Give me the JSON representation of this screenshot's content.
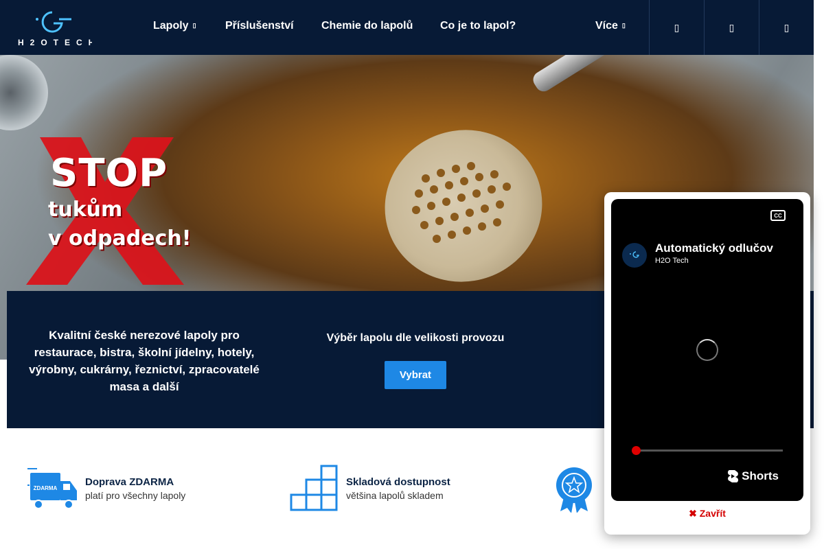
{
  "header": {
    "logo_text": "H2OTECH",
    "nav": [
      {
        "label": "Lapoly",
        "has_caret": true
      },
      {
        "label": "Příslušenství"
      },
      {
        "label": "Chemie do lapolů"
      },
      {
        "label": "Co je to lapol?"
      },
      {
        "label": "Více",
        "has_caret": true
      }
    ],
    "icons": [
      "search-icon",
      "user-icon",
      "cart-icon"
    ]
  },
  "hero": {
    "stop_title": "STOP",
    "stop_line1": "tukům",
    "stop_line2": "v odpadech!"
  },
  "strip": {
    "intro": "Kvalitní české nerezové lapoly pro restaurace, bistra, školní jídelny, hotely, výrobny, cukrárny, řeznictví, zpracovatelé masa a další",
    "select_title": "Výběr lapolu dle velikosti provozu",
    "select_button": "Vybrat"
  },
  "features": [
    {
      "title": "Doprava ZDARMA",
      "subtitle": "platí pro všechny lapoly",
      "icon": "truck-icon",
      "icon_label": "ZDARMA"
    },
    {
      "title": "Skladová dostupnost",
      "subtitle": "většina lapolů skladem",
      "icon": "boxes-icon"
    },
    {
      "title": "",
      "subtitle": "",
      "icon": "award-icon"
    }
  ],
  "video_popup": {
    "title": "Automatický odlučov",
    "channel": "H2O Tech",
    "cc_label": "CC",
    "shorts_label": "Shorts",
    "progress": 0.0,
    "close_label": "✖ Zavřít"
  },
  "colors": {
    "navy": "#071a36",
    "accent_blue": "#1e88e5",
    "close_red": "#d40000"
  }
}
